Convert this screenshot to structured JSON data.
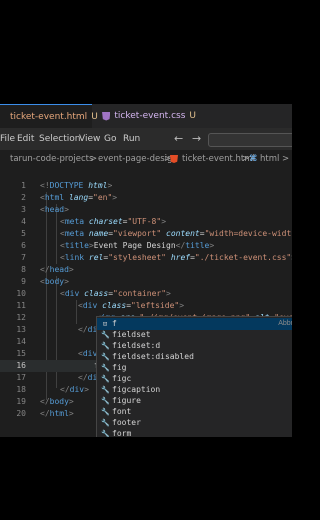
{
  "tabs": [
    {
      "label": "ticket-event.html",
      "status": "U",
      "type": "html"
    },
    {
      "label": "ticket-event.css",
      "status": "U",
      "type": "css"
    }
  ],
  "menu": [
    "File",
    "Edit",
    "Selection",
    "View",
    "Go",
    "Run"
  ],
  "breadcrumb": [
    "tarun-code-projects",
    ">",
    "event-page-design",
    ">",
    "ticket-event.html",
    ">",
    "html",
    ">"
  ],
  "code": {
    "line_numbers": [
      "1",
      "2",
      "3",
      "4",
      "5",
      "6",
      "7",
      "8",
      "9",
      "10",
      "11",
      "12",
      "13",
      "14",
      "15",
      "16",
      "17",
      "18",
      "19",
      "20"
    ],
    "current_line": "16"
  },
  "suggest": {
    "items": [
      "f",
      "fieldset",
      "fieldset:d",
      "fieldset:disabled",
      "fig",
      "figc",
      "figcaption",
      "figure",
      "font",
      "footer",
      "form"
    ],
    "hint": "Abbr"
  },
  "colors": {
    "tag": "#569cd6",
    "attr": "#9cdcfe",
    "string": "#ce9178",
    "text": "#d4d4d4",
    "accent": "#3b8eea"
  }
}
